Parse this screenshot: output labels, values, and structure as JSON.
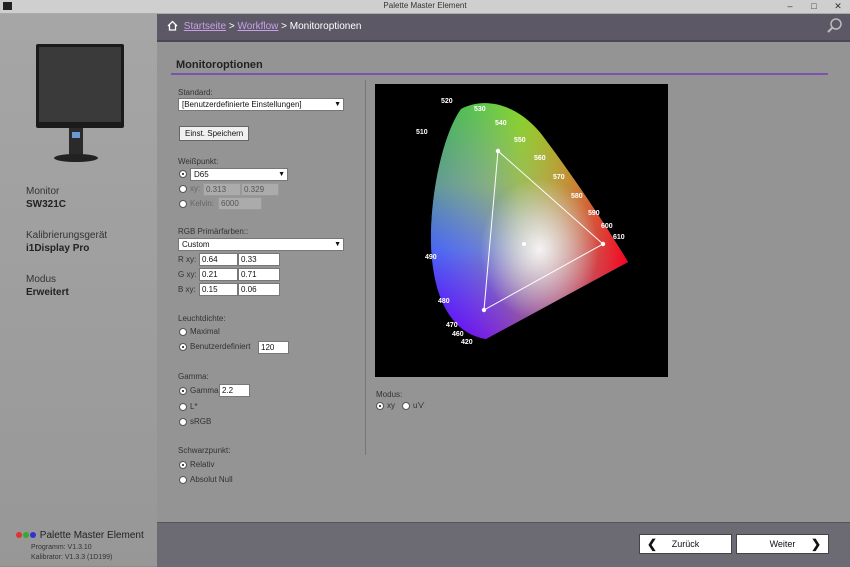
{
  "window": {
    "title": "Palette Master Element"
  },
  "sidebar": {
    "monitor_label": "Monitor",
    "monitor_value": "SW321C",
    "device_label": "Kalibrierungsgerät",
    "device_value": "i1Display Pro",
    "mode_label": "Modus",
    "mode_value": "Erweitert",
    "brand": "Palette Master Element",
    "program_version": "Programm: V1.3.10",
    "calibrator_version": "Kalibrator: V1.3.3 (1D199)"
  },
  "breadcrumb": {
    "home": "Startseite",
    "sep": ">",
    "workflow": "Workflow",
    "current": "Monitoroptionen"
  },
  "section": {
    "title": "Monitoroptionen"
  },
  "standard": {
    "label": "Standard:",
    "value": "[Benutzerdefinierte Einstellungen]",
    "save_button": "Einst. Speichern"
  },
  "whitepoint": {
    "label": "Weißpunkt:",
    "preset_value": "D65",
    "xy_label": "xy:",
    "x_value": "0.313",
    "y_value": "0.329",
    "kelvin_label": "Kelvin:",
    "kelvin_value": "6000"
  },
  "primaries": {
    "label": "RGB Primärfarben::",
    "select_value": "Custom",
    "r_label": "R xy:",
    "r_x": "0.64",
    "r_y": "0.33",
    "g_label": "G xy:",
    "g_x": "0.21",
    "g_y": "0.71",
    "b_label": "B xy:",
    "b_x": "0.15",
    "b_y": "0.06"
  },
  "luminance": {
    "label": "Leuchtdichte:",
    "max_label": "Maximal",
    "custom_label": "Benutzerdefiniert",
    "custom_value": "120"
  },
  "gamma": {
    "label": "Gamma:",
    "gamma_label": "Gamma",
    "gamma_value": "2.2",
    "lstar_label": "L*",
    "srgb_label": "sRGB"
  },
  "blackpoint": {
    "label": "Schwarzpunkt:",
    "relative_label": "Relativ",
    "absolute_label": "Absolut Null"
  },
  "cie": {
    "wavelengths": [
      "520",
      "530",
      "540",
      "550",
      "560",
      "570",
      "580",
      "590",
      "600",
      "610",
      "510",
      "490",
      "480",
      "470",
      "460",
      "420"
    ],
    "mode_label": "Modus:",
    "mode_xy": "xy",
    "mode_uv": "u'v'"
  },
  "footer": {
    "back_button": "Zurück",
    "next_button": "Weiter"
  },
  "colors": {
    "accent": "#7a52b0",
    "header": "#5c5866",
    "link": "#c9a0e8"
  }
}
